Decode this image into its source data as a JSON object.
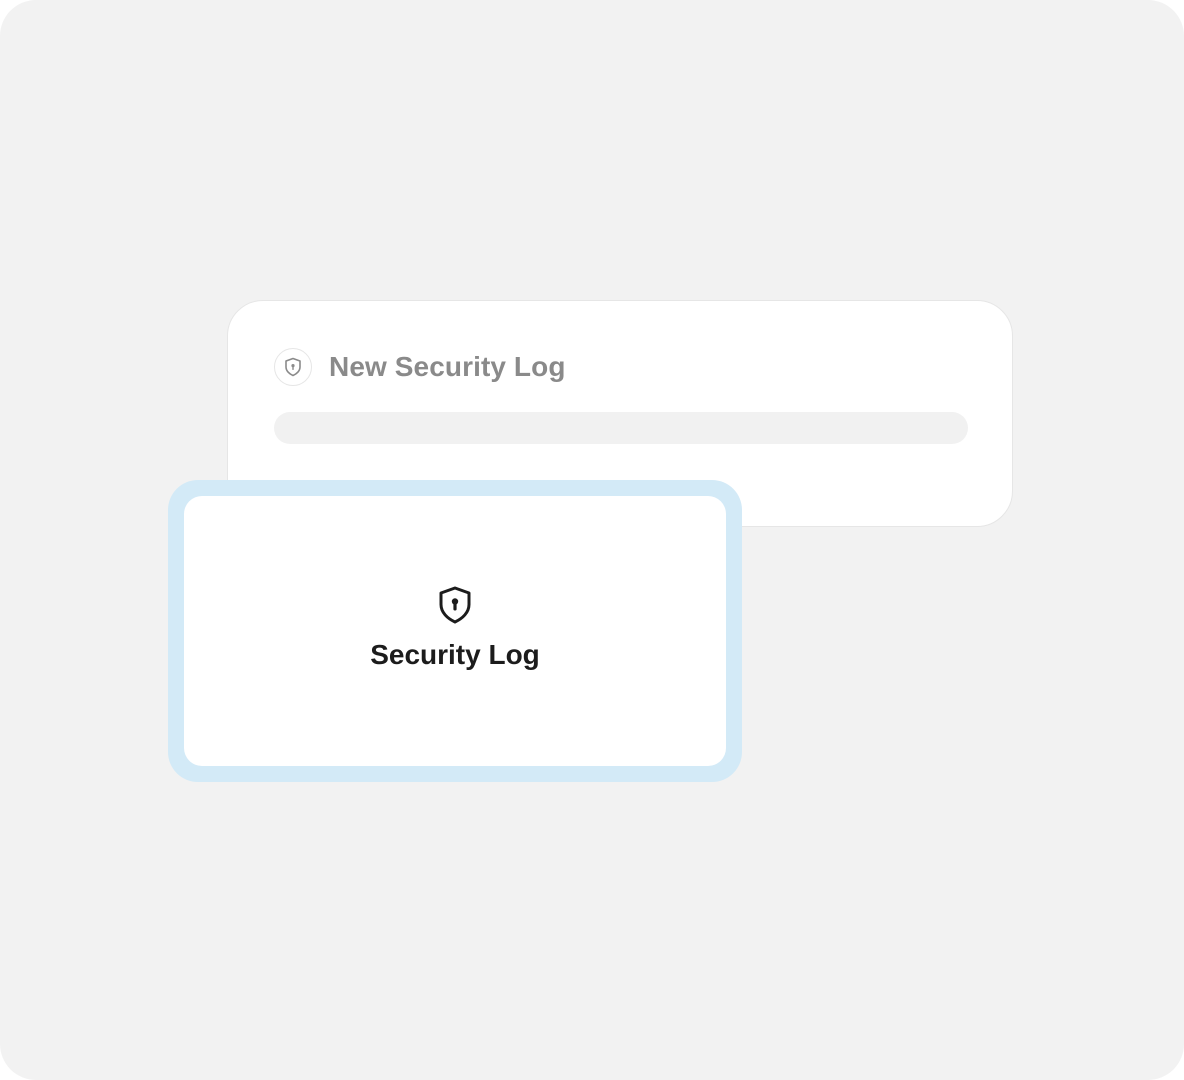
{
  "background_card": {
    "title": "New Security Log",
    "icon": "shield-lock-icon"
  },
  "selected_card": {
    "title": "Security Log",
    "icon": "shield-lock-icon",
    "highlight_color": "#d3eaf7"
  },
  "colors": {
    "canvas": "#f2f2f2",
    "card": "#ffffff",
    "muted_text": "#8a8a8a",
    "primary_text": "#1c1c1c"
  }
}
